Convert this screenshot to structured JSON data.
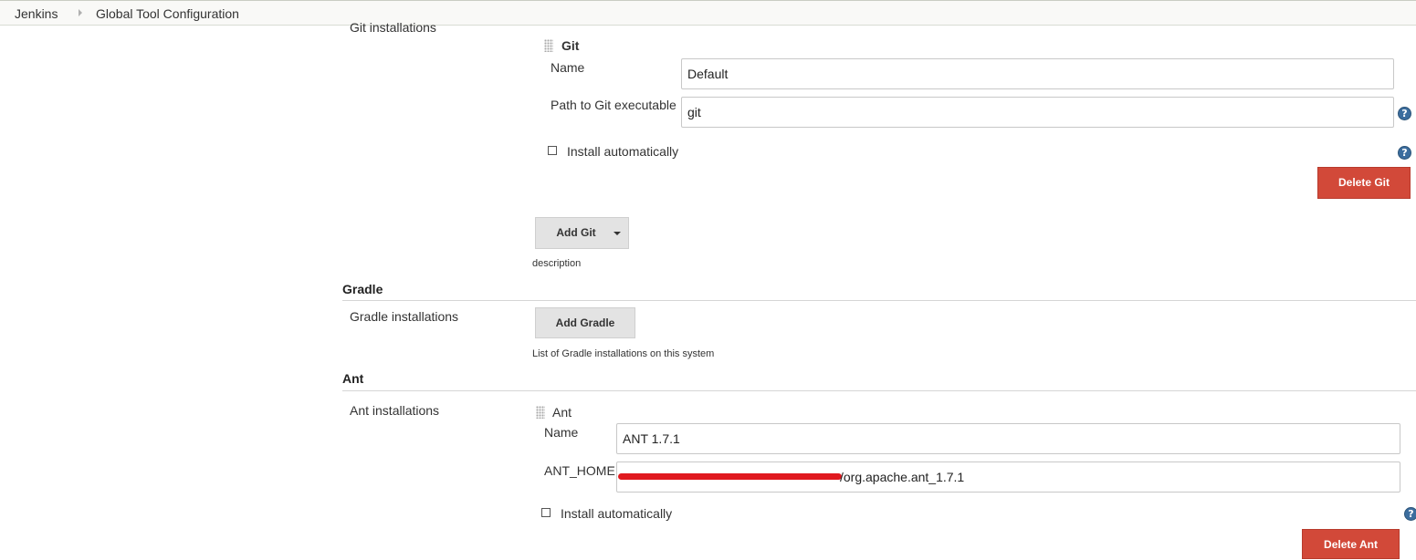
{
  "breadcrumb": {
    "items": [
      "Jenkins",
      "Global Tool Configuration"
    ]
  },
  "git_section": {
    "installations_label": "Git installations",
    "entry": {
      "header": "Git",
      "name_label": "Name",
      "name_value": "Default",
      "path_label": "Path to Git executable",
      "path_value": "git",
      "install_auto_label": "Install automatically",
      "install_auto_checked": false,
      "delete_label": "Delete Git"
    },
    "add_label": "Add Git",
    "description": "description"
  },
  "gradle_section": {
    "title": "Gradle",
    "installations_label": "Gradle installations",
    "add_label": "Add Gradle",
    "description": "List of Gradle installations on this system"
  },
  "ant_section": {
    "title": "Ant",
    "installations_label": "Ant installations",
    "entry": {
      "header": "Ant",
      "name_label": "Name",
      "name_value": "ANT 1.7.1",
      "home_label": "ANT_HOME",
      "home_value_visible": "/org.apache.ant_1.7.1",
      "install_auto_label": "Install automatically",
      "install_auto_checked": false,
      "delete_label": "Delete Ant"
    }
  },
  "colors": {
    "danger": "#d24939",
    "help": "#3c6d9e",
    "button_gray": "#e3e3e3",
    "redaction": "#e0191f"
  },
  "icons": [
    "grip-handle-icon",
    "help-icon",
    "chevron-down-icon",
    "checkbox"
  ]
}
